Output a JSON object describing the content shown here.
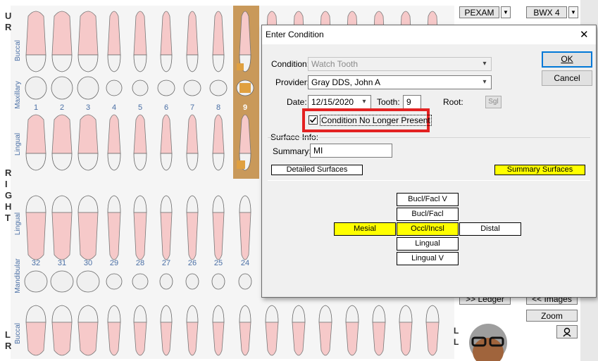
{
  "chart": {
    "side_letters_top": [
      "U",
      "R"
    ],
    "side_letters_right": [
      "R",
      "I",
      "G",
      "H",
      "T"
    ],
    "side_letters_bottom": [
      "L",
      "R"
    ],
    "zone_labels": {
      "upper_buccal": "Buccal",
      "maxillary": "Maxillary",
      "upper_lingual": "Lingual",
      "lower_lingual": "Lingual",
      "mandibular": "Mandibular",
      "lower_buccal": "Buccal"
    },
    "upper_numbers": [
      "1",
      "2",
      "3",
      "4",
      "5",
      "6",
      "7",
      "8",
      "9"
    ],
    "lower_numbers": [
      "32",
      "31",
      "30",
      "29",
      "28",
      "27",
      "26",
      "25",
      "24"
    ],
    "selected_tooth": "9"
  },
  "right_panel": {
    "pexam": "PEXAM",
    "bwx4": "BWX 4",
    "ledger": ">> Ledger",
    "images": "<< Images",
    "zoom": "Zoom",
    "partial_letters": [
      "L",
      "L"
    ]
  },
  "dialog": {
    "title": "Enter Condition",
    "close_glyph": "✕",
    "condition_label": "Condition:",
    "condition_value": "Watch Tooth",
    "provider_label": "Provider:",
    "provider_value": "Gray DDS, John A",
    "date_label": "Date:",
    "date_value": "12/15/2020",
    "tooth_label": "Tooth:",
    "tooth_value": "9",
    "root_label": "Root:",
    "sgl_label": "Sgl",
    "checkbox_label": "Condition No Longer Present",
    "checkbox_checked": true,
    "surface_info_label": "Surface Info:",
    "summary_label": "Summary:",
    "summary_value": "MI",
    "detailed_surfaces": "Detailed Surfaces",
    "summary_surfaces": "Summary Surfaces",
    "ok_label": "OK",
    "cancel_label": "Cancel",
    "surfaces": {
      "bucl_facl_v": "Bucl/Facl V",
      "bucl_facl": "Bucl/Facl",
      "mesial": "Mesial",
      "occl_incsl": "Occl/Incsl",
      "distal": "Distal",
      "lingual": "Lingual",
      "lingual_v": "Lingual V"
    },
    "highlight_color": "#ff0000",
    "selected_surface_color": "#ffff00"
  }
}
